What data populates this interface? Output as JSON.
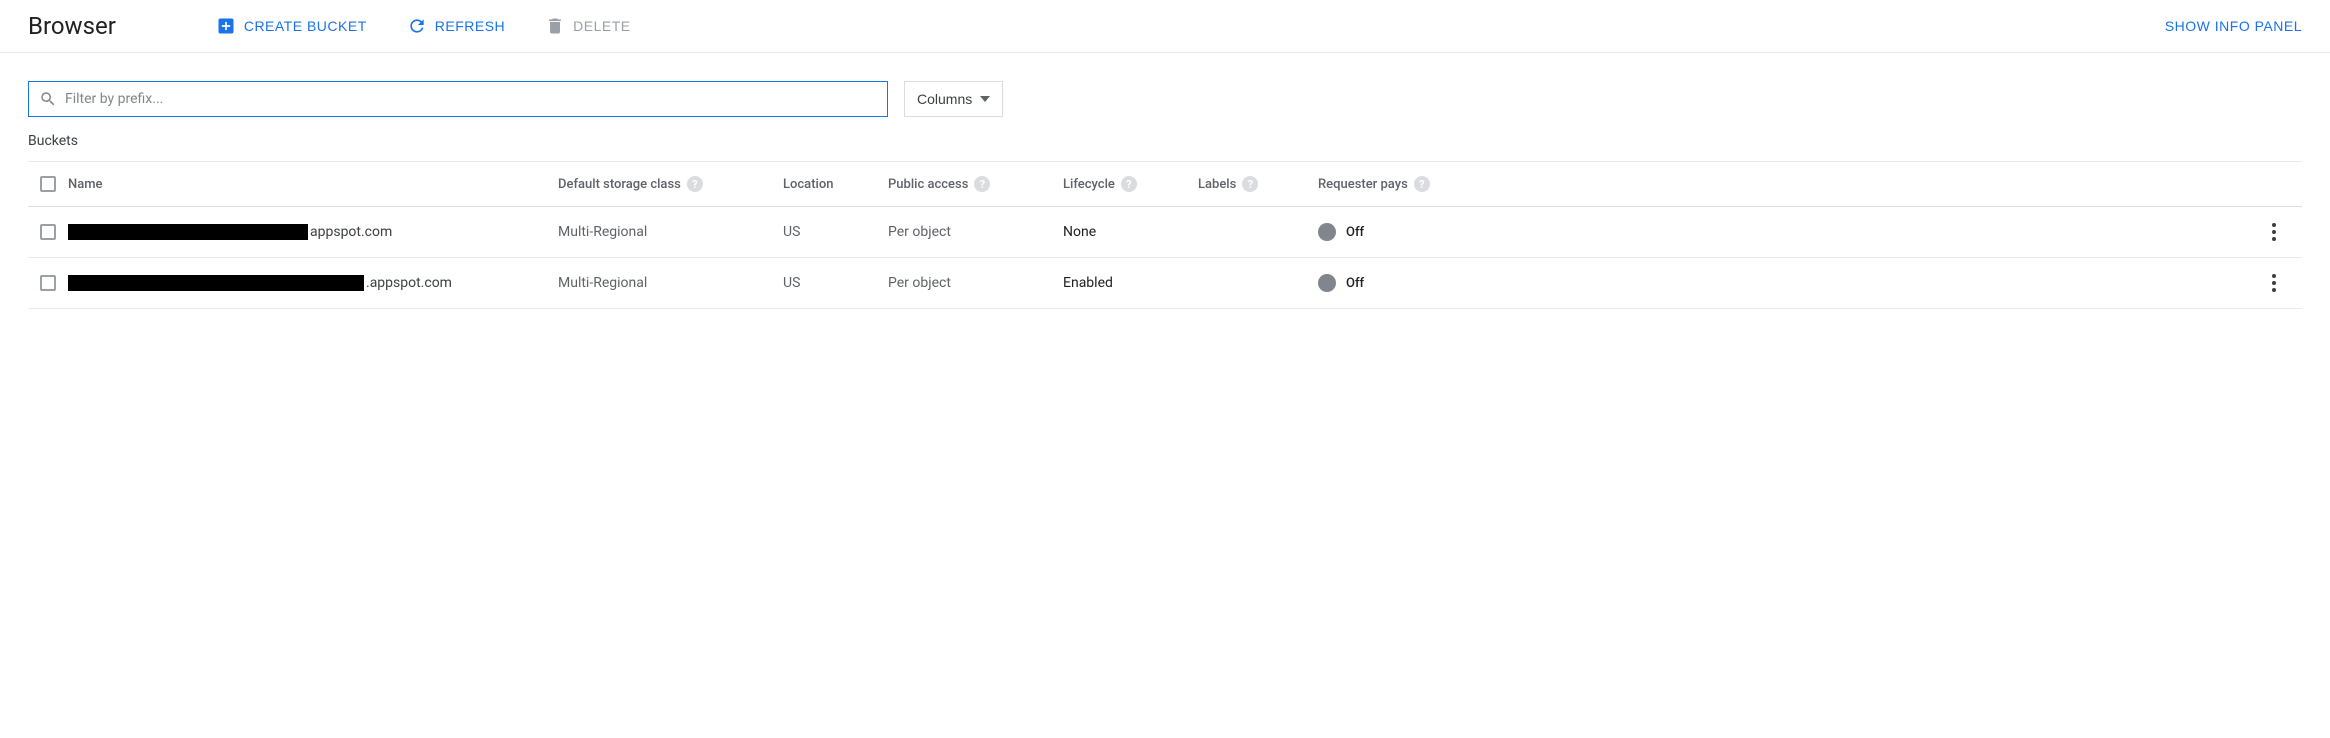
{
  "header": {
    "title": "Browser",
    "create_label": "CREATE BUCKET",
    "refresh_label": "REFRESH",
    "delete_label": "DELETE",
    "info_panel_label": "SHOW INFO PANEL"
  },
  "filter": {
    "placeholder": "Filter by prefix...",
    "value": ""
  },
  "columns_button": "Columns",
  "section_label": "Buckets",
  "columns": {
    "name": "Name",
    "storage": "Default storage class",
    "location": "Location",
    "access": "Public access",
    "lifecycle": "Lifecycle",
    "labels": "Labels",
    "requester": "Requester pays"
  },
  "rows": [
    {
      "name_suffix": "appspot.com",
      "redact_width": 240,
      "storage": "Multi-Regional",
      "location": "US",
      "access": "Per object",
      "lifecycle": "None",
      "labels": "",
      "requester": "Off"
    },
    {
      "name_suffix": ".appspot.com",
      "redact_width": 296,
      "storage": "Multi-Regional",
      "location": "US",
      "access": "Per object",
      "lifecycle": "Enabled",
      "labels": "",
      "requester": "Off"
    }
  ]
}
